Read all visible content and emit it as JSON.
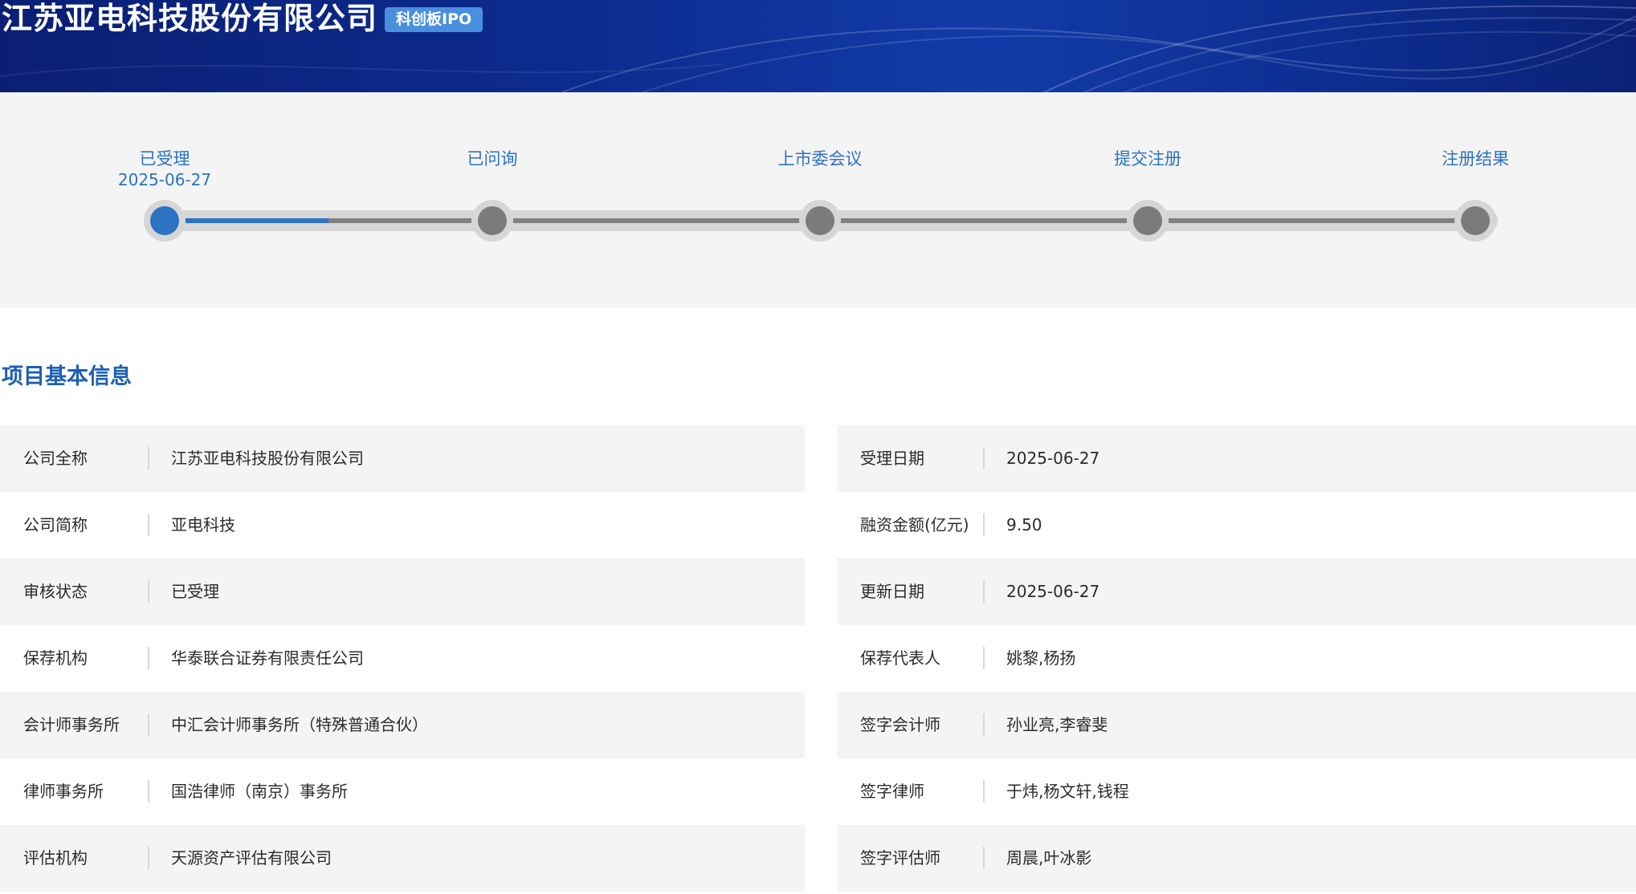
{
  "header": {
    "company_name": "江苏亚电科技股份有限公司",
    "board_badge": "科创板IPO"
  },
  "progress": {
    "steps": [
      {
        "label": "已受理",
        "date": "2025-06-27"
      },
      {
        "label": "已问询",
        "date": ""
      },
      {
        "label": "上市委会议",
        "date": ""
      },
      {
        "label": "提交注册",
        "date": ""
      },
      {
        "label": "注册结果",
        "date": ""
      }
    ],
    "current_step": 1,
    "fill_fraction": 0.125
  },
  "section": {
    "title": "项目基本信息"
  },
  "info_left": [
    {
      "label": "公司全称",
      "value": "江苏亚电科技股份有限公司"
    },
    {
      "label": "公司简称",
      "value": "亚电科技"
    },
    {
      "label": "审核状态",
      "value": "已受理"
    },
    {
      "label": "保荐机构",
      "value": "华泰联合证券有限责任公司"
    },
    {
      "label": "会计师事务所",
      "value": "中汇会计师事务所（特殊普通合伙）"
    },
    {
      "label": "律师事务所",
      "value": "国浩律师（南京）事务所"
    },
    {
      "label": "评估机构",
      "value": "天源资产评估有限公司"
    }
  ],
  "info_right": [
    {
      "label": "受理日期",
      "value": "2025-06-27"
    },
    {
      "label": "融资金额(亿元)",
      "value": "9.50"
    },
    {
      "label": "更新日期",
      "value": "2025-06-27"
    },
    {
      "label": "保荐代表人",
      "value": "姚黎,杨扬"
    },
    {
      "label": "签字会计师",
      "value": "孙业亮,李睿斐"
    },
    {
      "label": "签字律师",
      "value": "于炜,杨文轩,钱程"
    },
    {
      "label": "签字评估师",
      "value": "周晨,叶冰影"
    }
  ],
  "colors": {
    "accent": "#2d73c2",
    "banner": "#0d2b8f",
    "badge": "#4a8fde",
    "row_shade": "#f4f4f4"
  }
}
